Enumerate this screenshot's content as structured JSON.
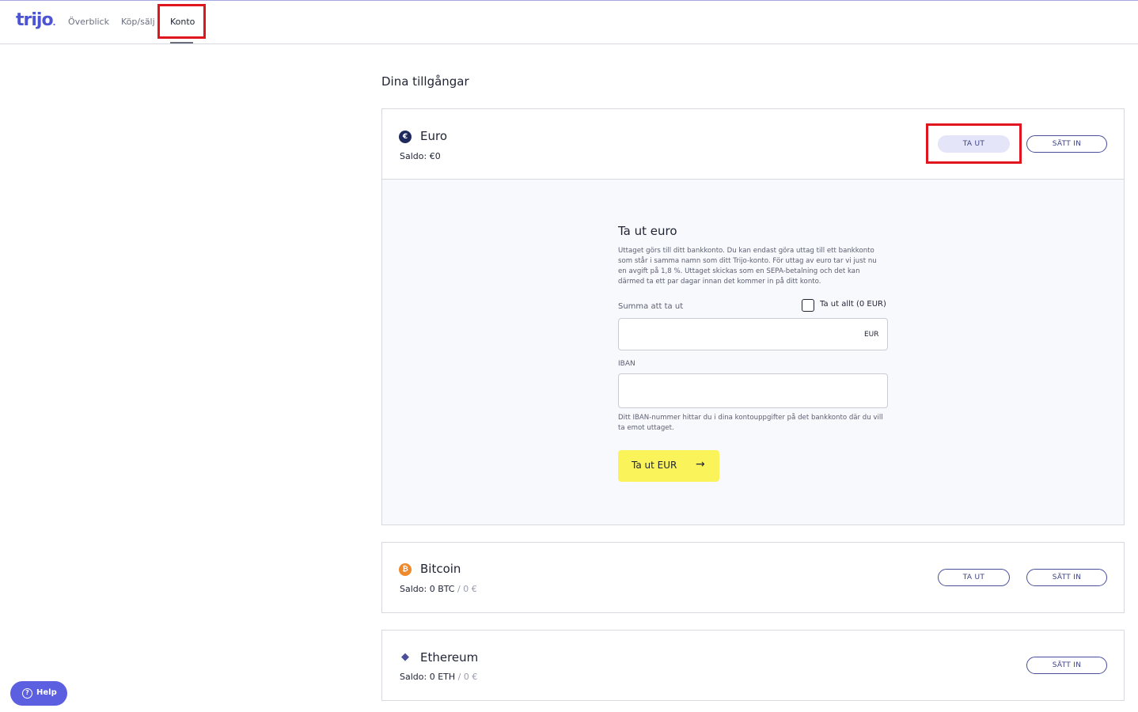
{
  "brand": {
    "logo": "trijo",
    "accent": "#4c54d4"
  },
  "nav": {
    "items": [
      {
        "label": "Överblick"
      },
      {
        "label": "Köp/sälj"
      },
      {
        "label": "Konto"
      }
    ],
    "active": "Konto"
  },
  "page": {
    "title": "Dina tillgångar"
  },
  "assets": [
    {
      "name": "Euro",
      "icon": "euro-icon",
      "icon_glyph": "€",
      "icon_color": "#1f2a5c",
      "balance_prefix": "Saldo: €0",
      "buttons": {
        "withdraw": "TA UT",
        "deposit": "SÄTT IN"
      }
    },
    {
      "name": "Bitcoin",
      "icon": "bitcoin-icon",
      "icon_glyph": "₿",
      "icon_color": "#f0892b",
      "balance_prefix": "Saldo: 0 BTC",
      "balance_sep": "/",
      "balance_fiat": "0 €",
      "buttons": {
        "withdraw": "TA UT",
        "deposit": "SÄTT IN"
      }
    },
    {
      "name": "Ethereum",
      "icon": "ethereum-icon",
      "icon_glyph": "◆",
      "icon_color": "#4a4f9c",
      "balance_prefix": "Saldo: 0 ETH",
      "balance_sep": "/",
      "balance_fiat": "0 €",
      "buttons": {
        "deposit": "SÄTT IN"
      }
    }
  ],
  "withdraw_form": {
    "title": "Ta ut euro",
    "description": "Uttaget görs till ditt bankkonto. Du kan endast göra uttag till ett bankkonto som står i samma namn som ditt Trijo-konto. För uttag av euro tar vi just nu en avgift på 1,8 %. Uttaget skickas som en SEPA-betalning och det kan därmed ta ett par dagar innan det kommer in på ditt konto.",
    "amount_label": "Summa att ta ut",
    "withdraw_all_label": "Ta ut allt (0 EUR)",
    "amount_value": "",
    "amount_suffix": "EUR",
    "iban_label": "IBAN",
    "iban_value": "",
    "iban_hint": "Ditt IBAN-nummer hittar du i dina kontouppgifter på det bankkonto där du vill ta emot uttaget.",
    "submit_label": "Ta ut EUR",
    "submit_icon": "arrow-right-icon",
    "submit_color": "#fbf35a"
  },
  "help": {
    "label": "Help",
    "icon": "question-icon"
  }
}
